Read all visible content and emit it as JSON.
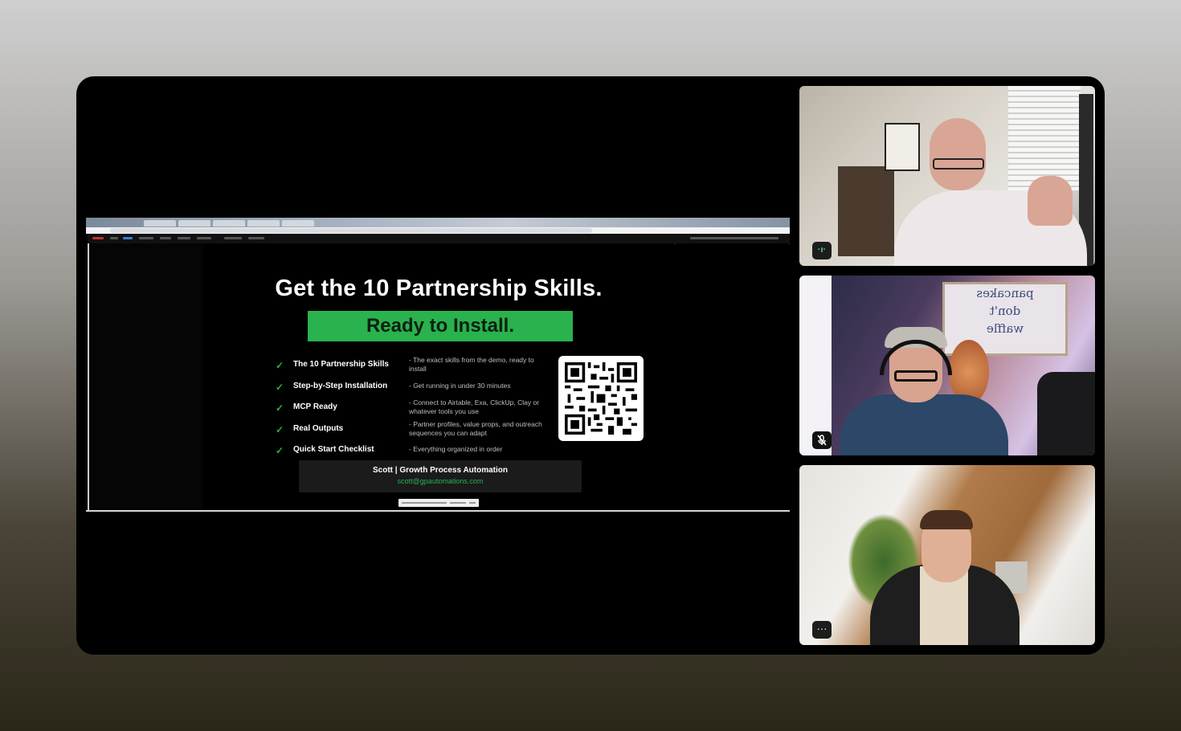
{
  "shared_screen": {
    "slide": {
      "title": "Get the 10 Partnership Skills.",
      "banner": "Ready to Install.",
      "features": [
        {
          "name": "The 10 Partnership Skills",
          "desc": "- The exact skills from the demo, ready to install"
        },
        {
          "name": "Step-by-Step Installation",
          "desc": "- Get running in under 30 minutes"
        },
        {
          "name": "MCP Ready",
          "desc": "- Connect to Airtable, Exa, ClickUp, Clay or whatever tools you use"
        },
        {
          "name": "Real Outputs",
          "desc": "- Partner profiles, value props, and outreach sequences you can adapt"
        },
        {
          "name": "Quick Start Checklist",
          "desc": "- Everything organized in order"
        }
      ],
      "check_glyph": "✓",
      "contact_name": "Scott | Growth Process Automation",
      "contact_email": "scott@gpautomations.com",
      "qr_icon": "qr-code"
    }
  },
  "participants": [
    {
      "status_icon": "speaking-indicator-icon",
      "badge_text": "·ı·"
    },
    {
      "status_icon": "mic-muted-icon",
      "sign_text": [
        "pancakes",
        "don't",
        "waffle"
      ]
    },
    {
      "status_icon": "more-options-icon",
      "badge_text": "···"
    }
  ],
  "colors": {
    "accent_green": "#29b24d",
    "background": "#000000"
  }
}
